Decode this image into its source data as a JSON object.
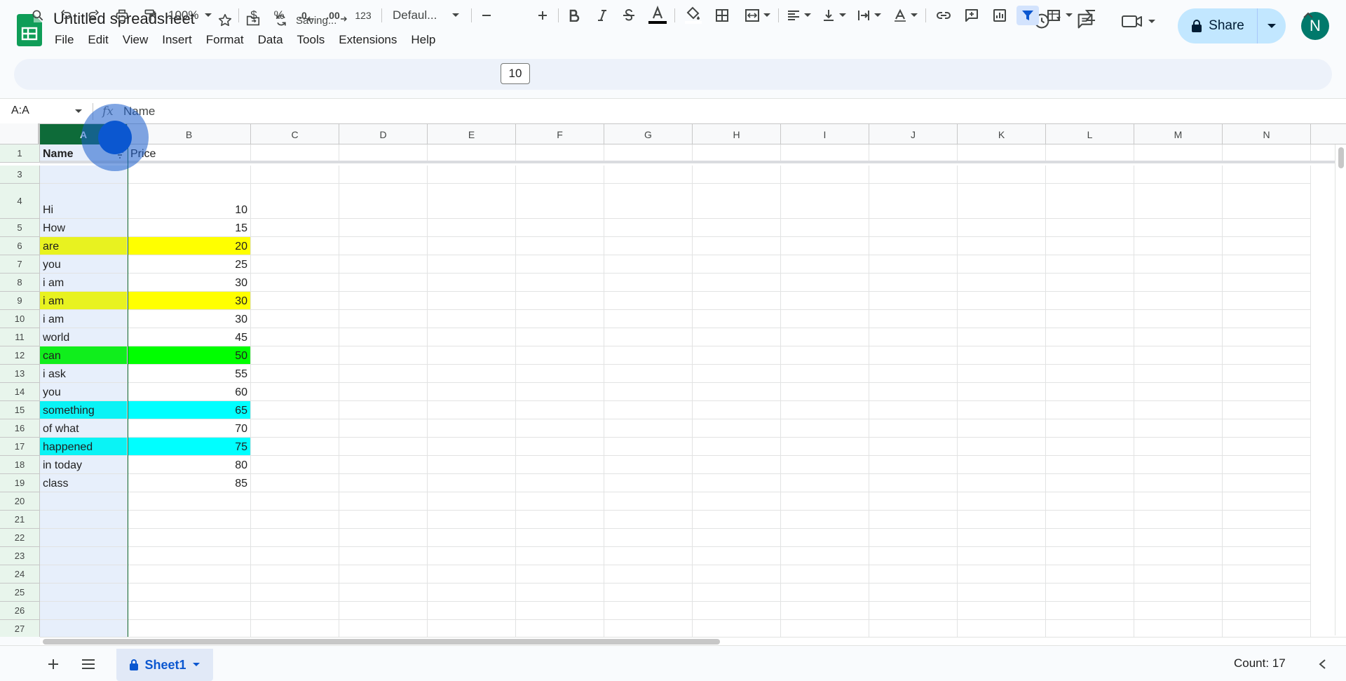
{
  "app": {
    "title": "Untitled spreadsheet",
    "status": "Saving..."
  },
  "menu": [
    "File",
    "Edit",
    "View",
    "Insert",
    "Format",
    "Data",
    "Tools",
    "Extensions",
    "Help"
  ],
  "share": {
    "label": "Share"
  },
  "avatar": {
    "initial": "N",
    "color": "#00796b"
  },
  "toolbar": {
    "zoom": "100%",
    "currency": "$",
    "percent": "%",
    "dec_decrease": ".0",
    "dec_increase": ".00",
    "number_format": "123",
    "font": "Defaul...",
    "font_size": "10"
  },
  "formula_bar": {
    "name_box": "A:A",
    "fx": "fx",
    "content": "Name"
  },
  "columns": [
    "A",
    "B",
    "C",
    "D",
    "E",
    "F",
    "G",
    "H",
    "I",
    "J",
    "K",
    "L",
    "M",
    "N"
  ],
  "rows": [
    {
      "num": "1",
      "a": "Name",
      "b": "Price",
      "bold": true
    },
    {
      "num": "3",
      "a": "",
      "b": ""
    },
    {
      "num": "4",
      "a": "Hi",
      "b": "10"
    },
    {
      "num": "5",
      "a": "How",
      "b": "15"
    },
    {
      "num": "6",
      "a": "are",
      "b": "20",
      "fill": "#ffff00"
    },
    {
      "num": "7",
      "a": "you",
      "b": "25"
    },
    {
      "num": "8",
      "a": "i am",
      "b": "30"
    },
    {
      "num": "9",
      "a": "i am",
      "b": "30",
      "fill": "#ffff00"
    },
    {
      "num": "10",
      "a": "i am",
      "b": "30"
    },
    {
      "num": "11",
      "a": "world",
      "b": "45"
    },
    {
      "num": "12",
      "a": "can",
      "b": "50",
      "fill": "#00ff00"
    },
    {
      "num": "13",
      "a": "i ask",
      "b": "55"
    },
    {
      "num": "14",
      "a": "you",
      "b": "60"
    },
    {
      "num": "15",
      "a": "something",
      "b": "65",
      "fill": "#00ffff"
    },
    {
      "num": "16",
      "a": "of what",
      "b": "70"
    },
    {
      "num": "17",
      "a": "happened",
      "b": "75",
      "fill": "#00ffff"
    },
    {
      "num": "18",
      "a": "in today",
      "b": "80"
    },
    {
      "num": "19",
      "a": "class",
      "b": "85"
    },
    {
      "num": "20",
      "a": "",
      "b": ""
    },
    {
      "num": "21",
      "a": "",
      "b": ""
    },
    {
      "num": "22",
      "a": "",
      "b": ""
    },
    {
      "num": "23",
      "a": "",
      "b": ""
    },
    {
      "num": "24",
      "a": "",
      "b": ""
    },
    {
      "num": "25",
      "a": "",
      "b": ""
    },
    {
      "num": "26",
      "a": "",
      "b": ""
    },
    {
      "num": "27",
      "a": "",
      "b": ""
    }
  ],
  "sheet": {
    "name": "Sheet1"
  },
  "status_bar": {
    "count": "Count: 17"
  }
}
